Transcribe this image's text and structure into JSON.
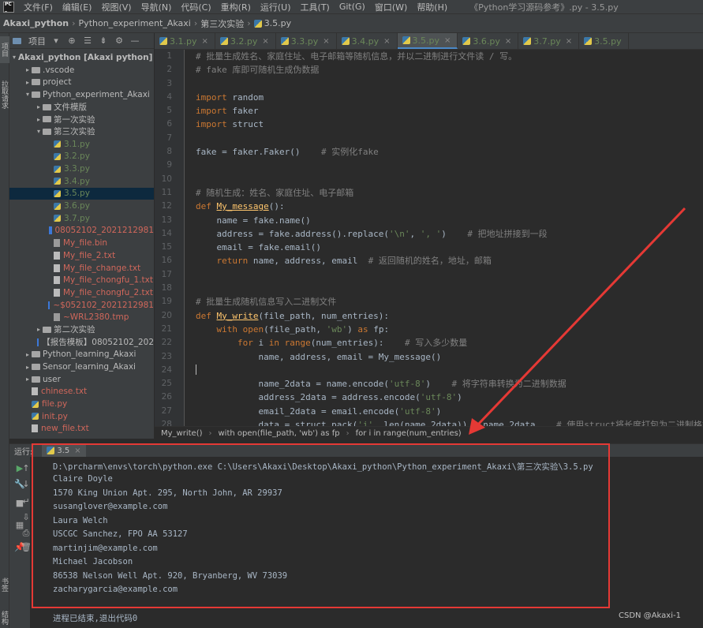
{
  "menubar": {
    "items": [
      "文件(F)",
      "编辑(E)",
      "视图(V)",
      "导航(N)",
      "代码(C)",
      "重构(R)",
      "运行(U)",
      "工具(T)",
      "Git(G)",
      "窗口(W)",
      "帮助(H)"
    ],
    "window_title": "《Python学习源码参考》.py - 3.5.py"
  },
  "navbar": {
    "crumbs": [
      "Akaxi_python",
      "Python_experiment_Akaxi",
      "第三次实验",
      "3.5.py"
    ]
  },
  "left_stripe": {
    "project": "项目",
    "pull_requests": "拉取请求",
    "bookmarks": "书签",
    "structure": "结构"
  },
  "project_panel": {
    "title": "项目",
    "tree": [
      {
        "label": "Akaxi_python [Akaxi python]",
        "suffix": "D:\\",
        "level": 0,
        "type": "root"
      },
      {
        "label": ".vscode",
        "level": 1,
        "type": "folder"
      },
      {
        "label": "project",
        "level": 1,
        "type": "folder"
      },
      {
        "label": "Python_experiment_Akaxi",
        "level": 1,
        "type": "folder-open"
      },
      {
        "label": "文件模版",
        "level": 2,
        "type": "folder"
      },
      {
        "label": "第一次实验",
        "level": 2,
        "type": "folder"
      },
      {
        "label": "第三次实验",
        "level": 2,
        "type": "folder-open"
      },
      {
        "label": "3.1.py",
        "level": 3,
        "type": "py"
      },
      {
        "label": "3.2.py",
        "level": 3,
        "type": "py"
      },
      {
        "label": "3.3.py",
        "level": 3,
        "type": "py"
      },
      {
        "label": "3.4.py",
        "level": 3,
        "type": "py"
      },
      {
        "label": "3.5.py",
        "level": 3,
        "type": "py",
        "selected": true
      },
      {
        "label": "3.6.py",
        "level": 3,
        "type": "py"
      },
      {
        "label": "3.7.py",
        "level": 3,
        "type": "py"
      },
      {
        "label": "08052102_2021212981",
        "level": 3,
        "type": "word"
      },
      {
        "label": "My_file.bin",
        "level": 3,
        "type": "bin"
      },
      {
        "label": "My_file_2.txt",
        "level": 3,
        "type": "txt"
      },
      {
        "label": "My_file_change.txt",
        "level": 3,
        "type": "txt"
      },
      {
        "label": "My_file_chongfu_1.txt",
        "level": 3,
        "type": "txt"
      },
      {
        "label": "My_file_chongfu_2.txt",
        "level": 3,
        "type": "txt"
      },
      {
        "label": "~$052102_2021212981",
        "level": 3,
        "type": "word"
      },
      {
        "label": "~WRL2380.tmp",
        "level": 3,
        "type": "bin"
      },
      {
        "label": "第二次实验",
        "level": 2,
        "type": "folder"
      },
      {
        "label": "【报告模板】08052102_202",
        "level": 2,
        "type": "word-gray"
      },
      {
        "label": "Python_learning_Akaxi",
        "level": 1,
        "type": "folder"
      },
      {
        "label": "Sensor_learning_Akaxi",
        "level": 1,
        "type": "folder"
      },
      {
        "label": "user",
        "level": 1,
        "type": "folder"
      },
      {
        "label": "chinese.txt",
        "level": 1,
        "type": "txt"
      },
      {
        "label": "file.py",
        "level": 1,
        "type": "py-red"
      },
      {
        "label": "init.py",
        "level": 1,
        "type": "py-red"
      },
      {
        "label": "new_file.txt",
        "level": 1,
        "type": "txt"
      }
    ]
  },
  "editor_tabs": [
    "3.1.py",
    "3.2.py",
    "3.3.py",
    "3.4.py",
    "3.5.py",
    "3.6.py",
    "3.7.py",
    "3.5.py"
  ],
  "active_tab_index": 4,
  "editor": {
    "line_numbers": [
      "1",
      "2",
      "3",
      "4",
      "5",
      "6",
      "7",
      "8",
      "9",
      "10",
      "11",
      "12",
      "13",
      "14",
      "15",
      "16",
      "17",
      "18",
      "19",
      "20",
      "21",
      "22",
      "23",
      "24",
      "25",
      "26",
      "27",
      "28"
    ],
    "lines": [
      "# 批量生成姓名、家庭住址、电子邮箱等随机信息，并以二进制进行文件读 / 写。",
      "# fake 库即可随机生成伪数据",
      "",
      "import random",
      "import faker",
      "import struct",
      "",
      "fake = faker.Faker()    # 实例化fake",
      "",
      "",
      "# 随机生成：姓名、家庭住址、电子邮箱",
      "def My_message():",
      "    name = fake.name()",
      "    address = fake.address().replace('\\n', ', ')    # 把地址拼接到一段",
      "    email = fake.email()",
      "    return name, address, email  # 返回随机的姓名，地址，邮箱",
      "",
      "",
      "# 批量生成随机信息写入二进制文件",
      "def My_write(file_path, num_entries):",
      "    with open(file_path, 'wb') as fp:",
      "        for i in range(num_entries):    # 写入多少数量",
      "            name, address, email = My_message()",
      "",
      "            name_2data = name.encode('utf-8')    # 将字符串转换为二进制数据",
      "            address_2data = address.encode('utf-8')",
      "            email_2data = email.encode('utf-8')",
      "            data = struct.pack('i', len(name_2data)) + name_2data    # 使用struct将长度打包为二进制格式"
    ]
  },
  "editor_breadcrumb": [
    "My_write()",
    "with open(file_path, 'wb') as fp",
    "for i in range(num_entries)"
  ],
  "run_panel": {
    "label": "运行:",
    "tab": "3.5",
    "output": [
      "D:\\prcharm\\envs\\torch\\python.exe C:\\Users\\Akaxi\\Desktop\\Akaxi_python\\Python_experiment_Akaxi\\第三次实验\\3.5.py",
      "Claire Doyle",
      "1570 King Union Apt. 295, North John, AR 29937",
      "susanglover@example.com",
      "Laura Welch",
      "USCGC Sanchez, FPO AA 53127",
      "martinjim@example.com",
      "Michael Jacobson",
      "86538 Nelson Well Apt. 920, Bryanberg, WV 73039",
      "zacharygarcia@example.com",
      "",
      "进程已结束,退出代码0"
    ]
  },
  "watermark": "CSDN @Akaxi-1",
  "colors": {
    "annotation": "#e53935",
    "keyword": "#cc7832",
    "comment": "#808080",
    "string": "#6a8759",
    "function": "#ffc66d"
  }
}
